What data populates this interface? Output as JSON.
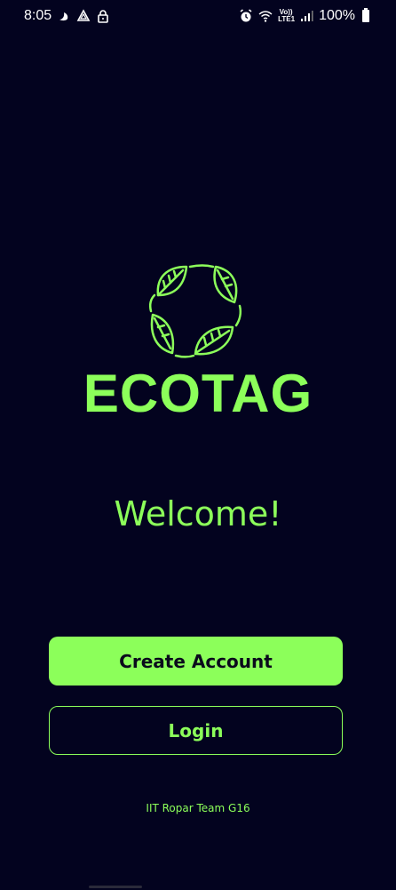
{
  "status_bar": {
    "time": "8:05",
    "left_icons": [
      "moon-icon",
      "drive-icon",
      "lock-icon"
    ],
    "right_icons": [
      "alarm-icon",
      "wifi-icon",
      "volte-icon",
      "signal-icon"
    ],
    "volte_line1": "Vo))",
    "volte_line2": "LTE1",
    "battery": "100%"
  },
  "logo": {
    "text": "ECOTAG",
    "icon": "leaves-ring-icon",
    "color": "#8cff5a"
  },
  "welcome": {
    "text": "Welcome!"
  },
  "buttons": {
    "create_account": "Create Account",
    "login": "Login"
  },
  "footer": {
    "text": "IIT Ropar Team G16"
  },
  "colors": {
    "background": "#03031f",
    "accent": "#8cff5a",
    "button_text_dark": "#0b0b1c"
  }
}
